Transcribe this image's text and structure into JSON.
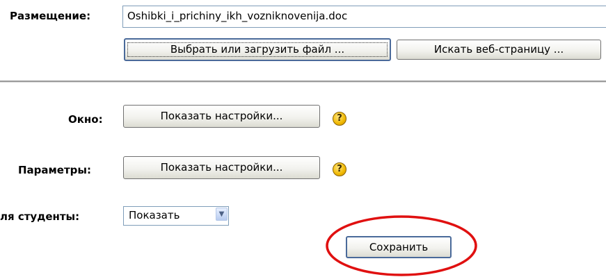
{
  "placement": {
    "label": "Размещение:",
    "file_value": "Oshibki_i_prichiny_ikh_vozniknovenija.doc",
    "choose_button": "Выбрать или загрузить файл ...",
    "search_web_button": "Искать веб-страницу ..."
  },
  "window": {
    "label": "Окно:",
    "show_settings_button": "Показать настройки...",
    "help_icon": "help-icon"
  },
  "parameters": {
    "label": "Параметры:",
    "show_settings_button": "Показать настройки...",
    "help_icon": "help-icon"
  },
  "students": {
    "label": "ля студенты:",
    "select_value": "Показать"
  },
  "save_button": "Сохранить",
  "help_glyph": "?",
  "dropdown_glyph": "▼",
  "colors": {
    "highlight_ring": "#e01010",
    "help_icon": "#f0b800",
    "field_border": "#7f9db9"
  }
}
